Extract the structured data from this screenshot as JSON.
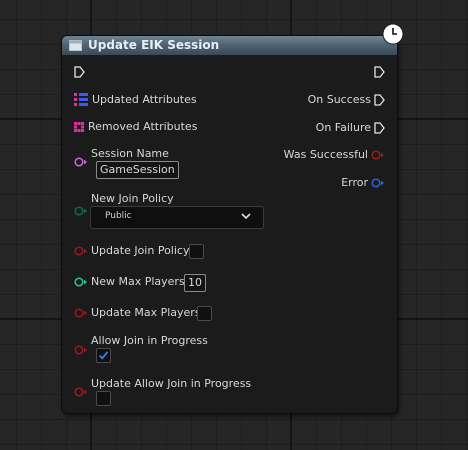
{
  "node": {
    "title": "Update EIK Session",
    "inputs": {
      "updated_attributes": "Updated Attributes",
      "removed_attributes": "Removed Attributes",
      "session_name": "Session Name",
      "session_name_value": "GameSession",
      "new_join_policy": "New Join Policy",
      "join_policy_value": "Public",
      "update_join_policy": "Update Join Policy",
      "new_max_players": "New Max Players",
      "new_max_players_value": "10",
      "update_max_players": "Update Max Players",
      "allow_join_in_progress": "Allow Join in Progress",
      "allow_join_in_progress_checked": true,
      "update_allow_join_in_progress": "Update Allow Join in Progress",
      "update_allow_join_in_progress_checked": false
    },
    "outputs": {
      "on_success": "On Success",
      "on_failure": "On Failure",
      "was_successful": "Was Successful",
      "error": "Error"
    }
  },
  "colors": {
    "background": "#262626",
    "grid_line": "#1c1c1c",
    "node_body": "#1b1b1b",
    "header_blue": "#4f6474",
    "pin_bool": "#9b1a1a",
    "pin_string": "#c86bd6",
    "pin_int": "#24c59a",
    "pin_enum": "#0f6a57",
    "pin_struct": "#2a64d8",
    "pin_map": "#d8339e",
    "check_blue": "#3a7ef0"
  },
  "icons": {
    "header": "function-icon",
    "latent": "clock-icon",
    "exec": "exec-arrow-icon",
    "array": "array-grid-icon",
    "set": "set-grid-icon",
    "dropdown": "chevron-down-icon",
    "check": "checkmark-icon"
  }
}
